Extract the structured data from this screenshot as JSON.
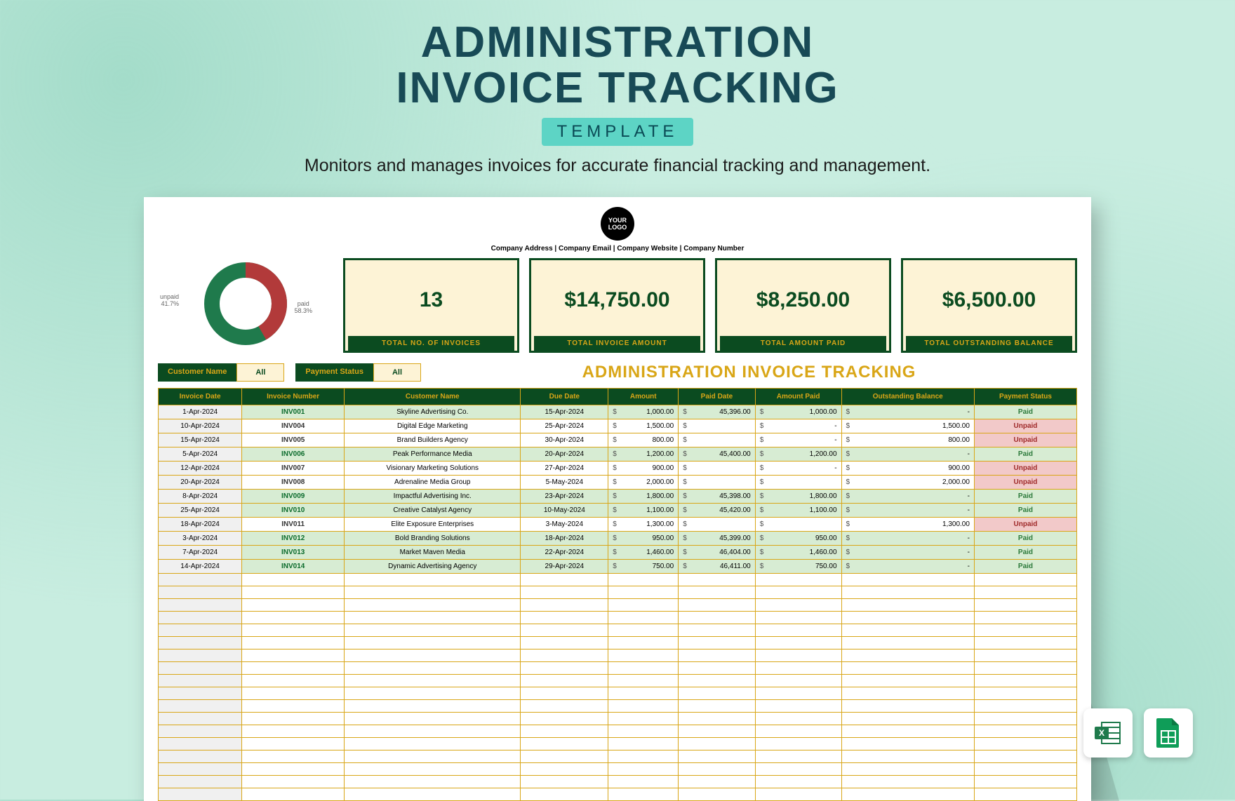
{
  "hero": {
    "line1": "ADMINISTRATION",
    "line2": "INVOICE TRACKING",
    "pill": "TEMPLATE",
    "subtitle": "Monitors and manages invoices for accurate financial tracking and management."
  },
  "sheet": {
    "logo_text": "YOUR LOGO",
    "company_meta": "Company Address  |  Company Email  |  Company Website  |  Company Number",
    "kpis": [
      {
        "value": "13",
        "label": "TOTAL NO. OF INVOICES"
      },
      {
        "value": "$14,750.00",
        "label": "TOTAL INVOICE AMOUNT"
      },
      {
        "value": "$8,250.00",
        "label": "TOTAL AMOUNT PAID"
      },
      {
        "value": "$6,500.00",
        "label": "TOTAL OUTSTANDING BALANCE"
      }
    ],
    "donut": {
      "unpaid_label": "unpaid",
      "unpaid_pct": "41.7%",
      "paid_label": "paid",
      "paid_pct": "58.3%"
    },
    "filters": {
      "customer_label": "Customer Name",
      "customer_value": "All",
      "status_label": "Payment Status",
      "status_value": "All"
    },
    "table_title": "ADMINISTRATION INVOICE TRACKING",
    "columns": [
      "Invoice Date",
      "Invoice Number",
      "Customer Name",
      "Due Date",
      "Amount",
      "Paid Date",
      "Amount Paid",
      "Outstanding Balance",
      "Payment Status"
    ],
    "rows": [
      {
        "date": "1-Apr-2024",
        "num": "INV001",
        "cust": "Skyline Advertising Co.",
        "due": "15-Apr-2024",
        "amt": "1,000.00",
        "pdate": "45,396.00",
        "apaid": "1,000.00",
        "out": "-",
        "status": "Paid",
        "paid": true
      },
      {
        "date": "10-Apr-2024",
        "num": "INV004",
        "cust": "Digital Edge Marketing",
        "due": "25-Apr-2024",
        "amt": "1,500.00",
        "pdate": "",
        "apaid": "-",
        "out": "1,500.00",
        "status": "Unpaid",
        "paid": false
      },
      {
        "date": "15-Apr-2024",
        "num": "INV005",
        "cust": "Brand Builders Agency",
        "due": "30-Apr-2024",
        "amt": "800.00",
        "pdate": "",
        "apaid": "-",
        "out": "800.00",
        "status": "Unpaid",
        "paid": false
      },
      {
        "date": "5-Apr-2024",
        "num": "INV006",
        "cust": "Peak Performance Media",
        "due": "20-Apr-2024",
        "amt": "1,200.00",
        "pdate": "45,400.00",
        "apaid": "1,200.00",
        "out": "-",
        "status": "Paid",
        "paid": true
      },
      {
        "date": "12-Apr-2024",
        "num": "INV007",
        "cust": "Visionary Marketing Solutions",
        "due": "27-Apr-2024",
        "amt": "900.00",
        "pdate": "",
        "apaid": "-",
        "out": "900.00",
        "status": "Unpaid",
        "paid": false
      },
      {
        "date": "20-Apr-2024",
        "num": "INV008",
        "cust": "Adrenaline Media Group",
        "due": "5-May-2024",
        "amt": "2,000.00",
        "pdate": "",
        "apaid": "",
        "out": "2,000.00",
        "status": "Unpaid",
        "paid": false
      },
      {
        "date": "8-Apr-2024",
        "num": "INV009",
        "cust": "Impactful Advertising Inc.",
        "due": "23-Apr-2024",
        "amt": "1,800.00",
        "pdate": "45,398.00",
        "apaid": "1,800.00",
        "out": "-",
        "status": "Paid",
        "paid": true
      },
      {
        "date": "25-Apr-2024",
        "num": "INV010",
        "cust": "Creative Catalyst Agency",
        "due": "10-May-2024",
        "amt": "1,100.00",
        "pdate": "45,420.00",
        "apaid": "1,100.00",
        "out": "-",
        "status": "Paid",
        "paid": true
      },
      {
        "date": "18-Apr-2024",
        "num": "INV011",
        "cust": "Elite Exposure Enterprises",
        "due": "3-May-2024",
        "amt": "1,300.00",
        "pdate": "",
        "apaid": "",
        "out": "1,300.00",
        "status": "Unpaid",
        "paid": false
      },
      {
        "date": "3-Apr-2024",
        "num": "INV012",
        "cust": "Bold Branding Solutions",
        "due": "18-Apr-2024",
        "amt": "950.00",
        "pdate": "45,399.00",
        "apaid": "950.00",
        "out": "-",
        "status": "Paid",
        "paid": true
      },
      {
        "date": "7-Apr-2024",
        "num": "INV013",
        "cust": "Market Maven Media",
        "due": "22-Apr-2024",
        "amt": "1,460.00",
        "pdate": "46,404.00",
        "apaid": "1,460.00",
        "out": "-",
        "status": "Paid",
        "paid": true
      },
      {
        "date": "14-Apr-2024",
        "num": "INV014",
        "cust": "Dynamic Advertising Agency",
        "due": "29-Apr-2024",
        "amt": "750.00",
        "pdate": "46,411.00",
        "apaid": "750.00",
        "out": "-",
        "status": "Paid",
        "paid": true
      }
    ],
    "empty_rows": 18
  },
  "chart_data": {
    "type": "pie",
    "title": "Payment Status",
    "series": [
      {
        "name": "unpaid",
        "value": 41.7,
        "color": "#b23a3a"
      },
      {
        "name": "paid",
        "value": 58.3,
        "color": "#1f7a4c"
      }
    ]
  },
  "icons": {
    "excel": "Excel",
    "sheets": "Google Sheets"
  }
}
